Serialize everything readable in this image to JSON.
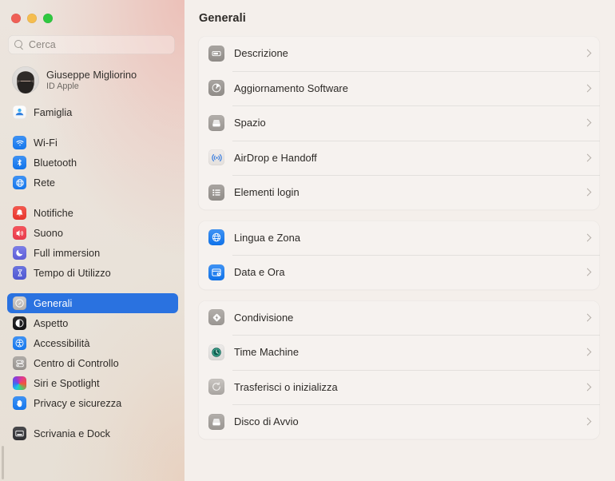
{
  "window": {
    "traffic_lights": [
      {
        "name": "close",
        "color": "#ef5f56"
      },
      {
        "name": "minimize",
        "color": "#f5bd4f"
      },
      {
        "name": "zoom",
        "color": "#2fc840"
      }
    ]
  },
  "sidebar": {
    "search": {
      "placeholder": "Cerca",
      "value": "",
      "icon": "search-icon"
    },
    "account": {
      "name": "Giuseppe Migliorino",
      "subtitle": "ID Apple",
      "avatar": "user-avatar"
    },
    "groups": [
      {
        "items": [
          {
            "label": "Famiglia",
            "icon": "family-icon",
            "selected": false
          }
        ]
      },
      {
        "items": [
          {
            "label": "Wi-Fi",
            "icon": "wifi-icon",
            "selected": false
          },
          {
            "label": "Bluetooth",
            "icon": "bluetooth-icon",
            "selected": false
          },
          {
            "label": "Rete",
            "icon": "network-globe-icon",
            "selected": false
          }
        ]
      },
      {
        "items": [
          {
            "label": "Notifiche",
            "icon": "notifications-bell-icon",
            "selected": false
          },
          {
            "label": "Suono",
            "icon": "sound-speaker-icon",
            "selected": false
          },
          {
            "label": "Full immersion",
            "icon": "focus-moon-icon",
            "selected": false
          },
          {
            "label": "Tempo di Utilizzo",
            "icon": "screen-time-hourglass-icon",
            "selected": false
          }
        ]
      },
      {
        "items": [
          {
            "label": "Generali",
            "icon": "general-gear-icon",
            "selected": true
          },
          {
            "label": "Aspetto",
            "icon": "appearance-contrast-icon",
            "selected": false
          },
          {
            "label": "Accessibilità",
            "icon": "accessibility-icon",
            "selected": false
          },
          {
            "label": "Centro di Controllo",
            "icon": "control-center-icon",
            "selected": false
          },
          {
            "label": "Siri e Spotlight",
            "icon": "siri-icon",
            "selected": false
          },
          {
            "label": "Privacy e sicurezza",
            "icon": "privacy-hand-icon",
            "selected": false
          }
        ]
      },
      {
        "items": [
          {
            "label": "Scrivania e Dock",
            "icon": "desktop-dock-icon",
            "selected": false
          }
        ]
      }
    ],
    "scrollbar": {
      "name": "sidebar-scrollbar"
    }
  },
  "main": {
    "title": "Generali",
    "cards": [
      {
        "rows": [
          {
            "label": "Descrizione",
            "icon": "about-mac-icon",
            "disclosure": "›"
          },
          {
            "label": "Aggiornamento Software",
            "icon": "software-update-icon",
            "disclosure": "›"
          },
          {
            "label": "Spazio",
            "icon": "storage-icon",
            "disclosure": "›"
          },
          {
            "label": "AirDrop e Handoff",
            "icon": "airdrop-icon",
            "disclosure": "›"
          },
          {
            "label": "Elementi login",
            "icon": "login-items-icon",
            "disclosure": "›"
          }
        ]
      },
      {
        "rows": [
          {
            "label": "Lingua e Zona",
            "icon": "language-region-globe-icon",
            "disclosure": "›"
          },
          {
            "label": "Data e Ora",
            "icon": "date-time-icon",
            "disclosure": "›"
          }
        ]
      },
      {
        "rows": [
          {
            "label": "Condivisione",
            "icon": "sharing-icon",
            "disclosure": "›"
          },
          {
            "label": "Time Machine",
            "icon": "time-machine-icon",
            "disclosure": "›"
          },
          {
            "label": "Trasferisci o inizializza",
            "icon": "transfer-reset-icon",
            "disclosure": "›"
          },
          {
            "label": "Disco di Avvio",
            "icon": "startup-disk-icon",
            "disclosure": "›"
          }
        ]
      }
    ]
  }
}
